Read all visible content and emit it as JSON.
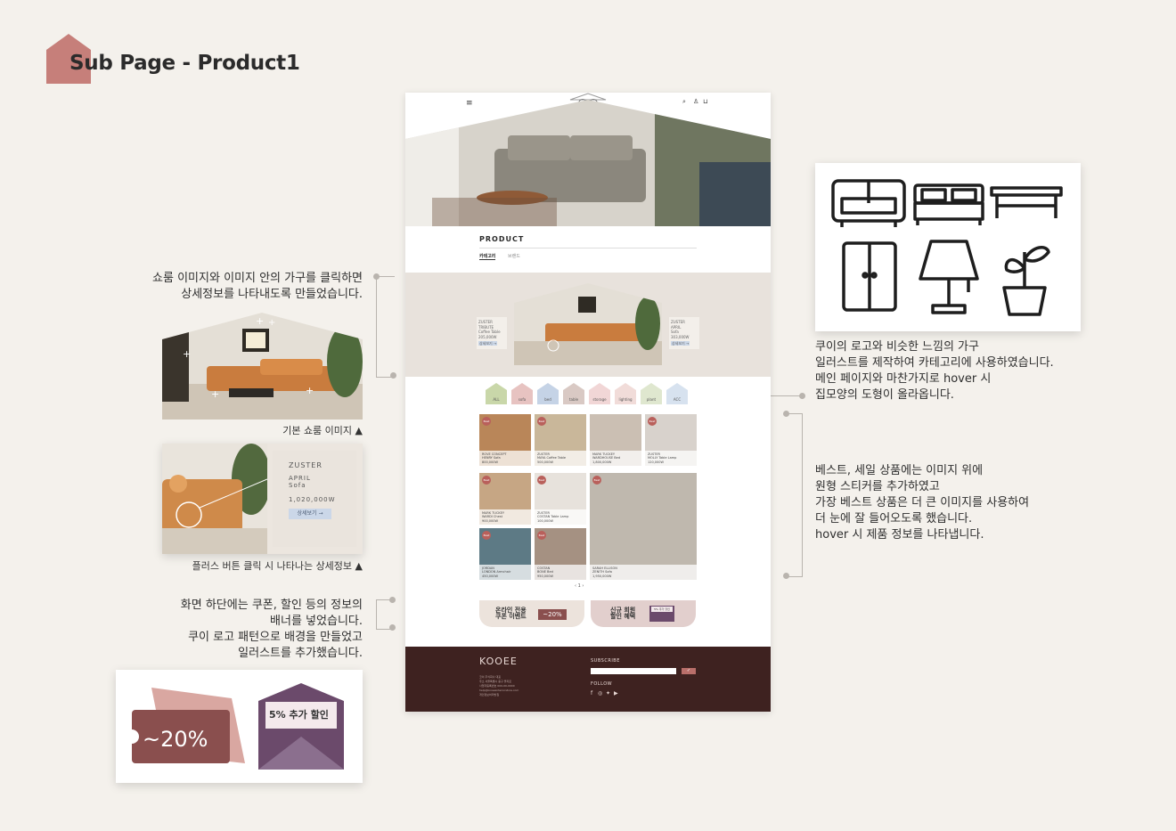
{
  "page": {
    "title": "Sub Page - Product1"
  },
  "annotations": {
    "showroom_text_1": "쇼룸 이미지와 이미지 안의 가구를 클릭하면",
    "showroom_text_2": "상세정보를 나타내도록 만들었습니다.",
    "showroom_caption": "기본 쇼룸 이미지 ▲",
    "detail_caption": "플러스 버튼 클릭 시 나타나는 상세정보 ▲",
    "banner_text_1": "화면 하단에는 쿠폰, 할인 등의 정보의",
    "banner_text_2": "배너를 넣었습니다.",
    "banner_text_3": "쿠이 로고 패턴으로 배경을 만들었고",
    "banner_text_4": "일러스트를 추가했습니다.",
    "category_text_1": "쿠이의 로고와 비슷한 느낌의 가구",
    "category_text_2": "일러스트를 제작하여 카테고리에 사용하였습니다.",
    "category_text_3": "메인 페이지와 마찬가지로 hover 시",
    "category_text_4": "집모양의 도형이 올라옵니다.",
    "best_text_1": "베스트, 세일 상품에는 이미지 위에",
    "best_text_2": "원형 스티커를 추가하였고",
    "best_text_3": "가장 베스트 상품은 더 큰 이미지를 사용하여",
    "best_text_4": "더 눈에 잘 들어오도록 했습니다.",
    "best_text_5": "hover 시 제품 정보를 나타냅니다."
  },
  "detail_card": {
    "brand": "ZUSTER",
    "name_1": "APRIL",
    "name_2": "Sofa",
    "price": "1,020,000W",
    "button": "상세보기 →"
  },
  "coupon_art": {
    "discount": "~20%",
    "envelope_text": "5% 추가 할인"
  },
  "mockup": {
    "section_title": "PRODUCT",
    "tab_category": "카테고리",
    "tab_brand": "브랜드",
    "left_card": {
      "brand": "ZUSTER",
      "name": "TRIBUTE",
      "type": "Coffee Table",
      "price": "205,000W",
      "button": "상세보기 →"
    },
    "right_card": {
      "brand": "ZUSTER",
      "name": "APRIL",
      "type": "Sofa",
      "price": "303,000W",
      "button": "상세보기 →"
    },
    "categories": [
      {
        "label": "ALL",
        "color": "#c9d7a9"
      },
      {
        "label": "sofa",
        "color": "#e7c3c1"
      },
      {
        "label": "bed",
        "color": "#c5d3e6"
      },
      {
        "label": "table",
        "color": "#d9c9c4"
      },
      {
        "label": "storage",
        "color": "#f1d6d6"
      },
      {
        "label": "lighting",
        "color": "#f1dcd9"
      },
      {
        "label": "plant",
        "color": "#dfe7cf"
      },
      {
        "label": "ACC",
        "color": "#d7e2ef"
      }
    ],
    "products": [
      {
        "brand": "ROVE CONCEPT",
        "name": "HENRY Sofa",
        "price": "800,000W",
        "badge": "Best",
        "color": "#b98659"
      },
      {
        "brand": "ZUSTER",
        "name": "MAYA Coffee Table",
        "price": "500,000W",
        "badge": "Best",
        "color": "#c9b79a"
      },
      {
        "brand": "MARK TUCKEY",
        "name": "WARDHOUSE Bed",
        "price": "1,800,000W",
        "badge": "",
        "color": "#cbbfb3"
      },
      {
        "brand": "ZUSTER",
        "name": "MOLLY Table Lamp",
        "price": "120,000W",
        "badge": "Best",
        "color": "#d8d2cc"
      },
      {
        "brand": "MARK TUCKEY",
        "name": "WARDI Chest",
        "price": "900,000W",
        "badge": "Best",
        "color": "#c6a684"
      },
      {
        "brand": "ZUSTER",
        "name": "COSTAN Table Lamp",
        "price": "100,000W",
        "badge": "Best",
        "color": "#e7e2dc"
      },
      {
        "brand": "JORDAN",
        "name": "LONDON Armchair",
        "price": "450,000W",
        "badge": "Best",
        "color": "#5d7a85"
      },
      {
        "brand": "COSTAN",
        "name": "BONE Bed",
        "price": "950,000W",
        "badge": "Best",
        "color": "#a59182"
      },
      {
        "brand": "SARAH ELLISON",
        "name": "ZENITH Sofa",
        "price": "1,950,000W",
        "badge": "Best",
        "color": "#bfb8ae"
      }
    ],
    "pagination": "‹  1  ›",
    "banner_1_line1": "온라인 전용",
    "banner_1_line2": "쿠폰 이벤트",
    "banner_1_tag": "~20%",
    "banner_2_line1": "신규 회원",
    "banner_2_line2": "할인 혜택",
    "banner_2_tag": "5% 추가 할인",
    "footer": {
      "logo": "KOOEE",
      "info_1": "코이 주식회사 대표",
      "info_2": "주소 서울특별시 중구 을지로",
      "info_3": "사업자등록번호 000-00-0000",
      "info_4": "help@kooeeinteriorstore.com",
      "info_5": "개인정보처리방침",
      "subscribe": "SUBSCRIBE",
      "follow": "FOLLOW",
      "background": "#3e2220"
    }
  },
  "colors": {
    "accent": "#c88a85",
    "footer": "#3e2220",
    "showroom_bg": "#e8e2dc"
  }
}
